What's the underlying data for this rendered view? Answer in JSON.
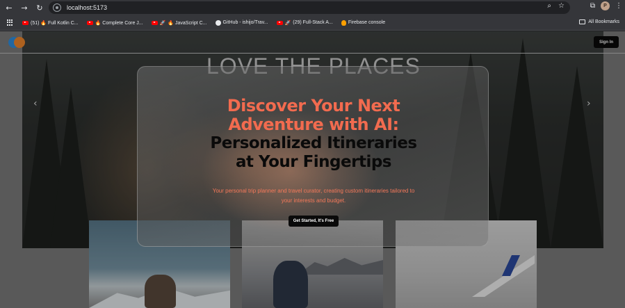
{
  "browser": {
    "url": "localhost:5173",
    "profile_initial": "P",
    "bookmarks": [
      {
        "label": "(51) 🔥 Full Kotlin C...",
        "icon": "youtube-icon"
      },
      {
        "label": "🔥 Complete Core J...",
        "icon": "youtube-icon"
      },
      {
        "label": "🔥 JavaScript C...",
        "icon": "youtube-icon"
      },
      {
        "label": "GitHub - ishijo/Trav...",
        "icon": "github-icon"
      },
      {
        "label": "(29) Full-Stack A...",
        "icon": "youtube-icon"
      },
      {
        "label": "Firebase console",
        "icon": "firebase-icon"
      }
    ],
    "all_bookmarks": "All Bookmarks"
  },
  "header": {
    "sign_in": "Sign In"
  },
  "hero": {
    "title": "LOVE THE PLACES"
  },
  "modal": {
    "title_accent_line1": "Discover Your Next",
    "title_accent_line2": "Adventure with AI:",
    "title_main_line1": "Personalized Itineraries",
    "title_main_line2": "at Your Fingertips",
    "subtitle_line1": "Your personal trip planner and travel curator, creating custom itineraries tailored to",
    "subtitle_line2": "your interests and budget.",
    "cta": "Get Started, It's Free"
  },
  "colors": {
    "accent": "#f26b4f",
    "dark": "#0a0a0a"
  }
}
